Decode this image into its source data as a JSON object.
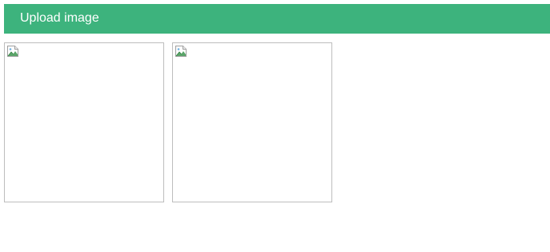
{
  "upload": {
    "label": "Upload image",
    "color": "#3db37d"
  },
  "gallery": {
    "items": [
      {
        "icon": "broken-image-icon"
      },
      {
        "icon": "broken-image-icon"
      }
    ]
  }
}
